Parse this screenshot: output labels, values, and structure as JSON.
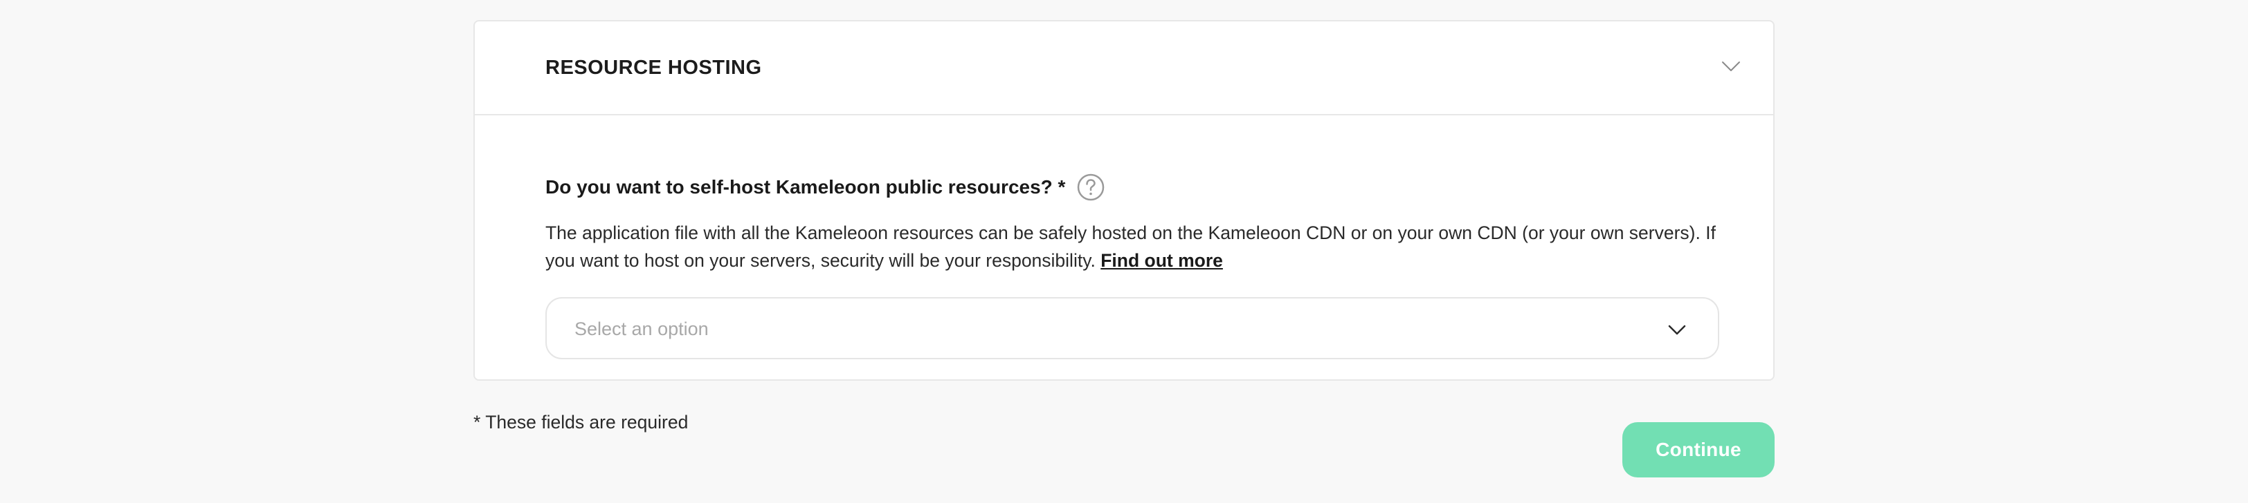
{
  "section": {
    "title": "RESOURCE HOSTING",
    "toggle_icon": "chevron-down-icon"
  },
  "question": {
    "label": "Do you want to self-host Kameleoon public resources? *",
    "help_icon": "question-mark-circle-icon"
  },
  "description": {
    "text": "The application file with all the Kameleoon resources can be safely hosted on the Kameleoon CDN or on your own CDN (or your own servers). If you want to host on your servers, security will be your responsibility. ",
    "link_label": "Find out more"
  },
  "select": {
    "placeholder": "Select an option",
    "icon": "chevron-down-icon"
  },
  "footer": {
    "required_note": "* These fields are required",
    "continue_label": "Continue"
  },
  "colors": {
    "background": "#f8f8f8",
    "card": "#ffffff",
    "border": "#e7e7e7",
    "continue_button": "#72dfb3",
    "placeholder": "#a8a8a8"
  }
}
